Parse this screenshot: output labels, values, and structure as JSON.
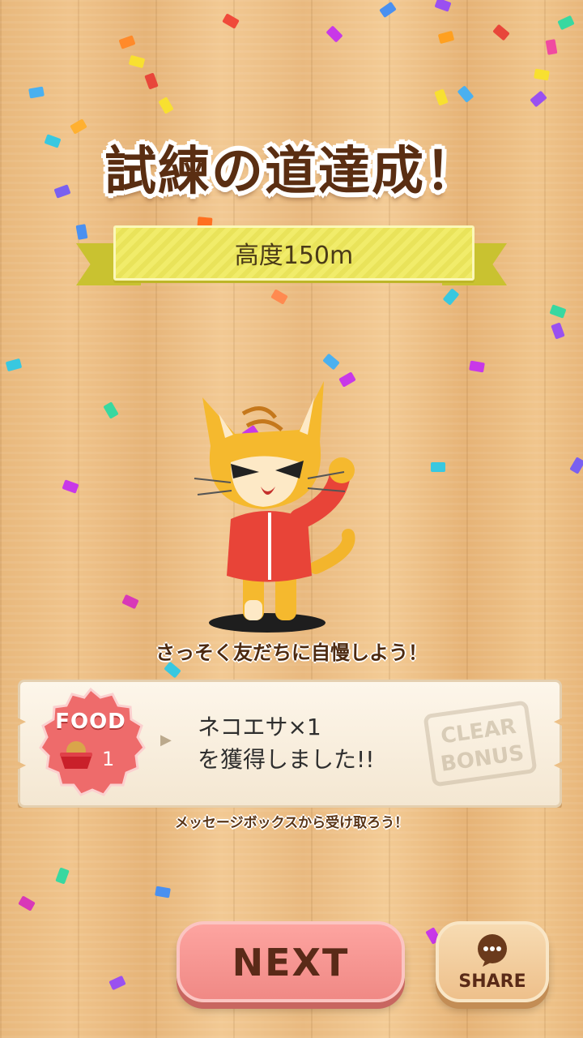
{
  "title": "試練の道達成！",
  "banner": {
    "height_label": "高度150m"
  },
  "caption": "さっそく友だちに自慢しよう！",
  "reward": {
    "badge_label": "FOOD",
    "count": "1",
    "line1": "ネコエサ×1",
    "line2": "を獲得しました!!",
    "stamp_text": "CLEAR BONUS",
    "hint": "メッセージボックスから受け取ろう！"
  },
  "buttons": {
    "next_label": "NEXT",
    "share_label": "SHARE"
  },
  "colors": {
    "next_button": "#f08985",
    "share_button": "#eec08b",
    "banner": "#f1ec6a",
    "badge": "#ee6b6b"
  }
}
